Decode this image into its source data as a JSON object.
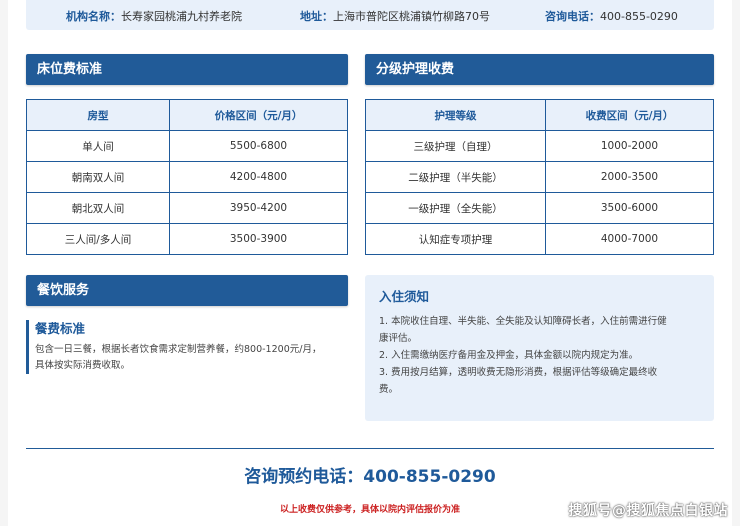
{
  "info": {
    "name_label": "机构名称：",
    "name_value": "长寿家园桃浦九村养老院",
    "addr_label": "地址：",
    "addr_value": "上海市普陀区桃浦镇竹柳路70号",
    "phone_label": "咨询电话：",
    "phone_value": "400-855-0290"
  },
  "bed_fee": {
    "title": "床位费标准",
    "headers": [
      "房型",
      "价格区间（元/月）"
    ],
    "rows": [
      [
        "单人间",
        "5500-6800"
      ],
      [
        "朝南双人间",
        "4200-4800"
      ],
      [
        "朝北双人间",
        "3950-4200"
      ],
      [
        "三人间/多人间",
        "3500-3900"
      ]
    ]
  },
  "care_fee": {
    "title": "分级护理收费",
    "headers": [
      "护理等级",
      "收费区间（元/月）"
    ],
    "rows": [
      [
        "三级护理（自理）",
        "1000-2000"
      ],
      [
        "二级护理（半失能）",
        "2000-3500"
      ],
      [
        "一级护理（全失能）",
        "3500-6000"
      ],
      [
        "认知症专项护理",
        "4000-7000"
      ]
    ]
  },
  "catering": {
    "title": "餐饮服务",
    "sub_title": "餐费标准",
    "line1": "包含一日三餐，根据长者饮食需求定制营养餐，约800-1200元/月，",
    "line2": "具体按实际消费收取。"
  },
  "notice": {
    "title": "入住须知",
    "items": [
      "1. 本院收住自理、半失能、全失能及认知障碍长者，入住前需进行健",
      "康评估。",
      "2. 入住需缴纳医疗备用金及押金，具体金额以院内规定为准。",
      "3. 费用按月结算，透明收费无隐形消费，根据评估等级确定最终收",
      "费。"
    ]
  },
  "footer": {
    "phone_line": "咨询预约电话：400-855-0290",
    "disclaimer": "以上收费仅供参考，具体以院内评估报价为准",
    "watermark": "搜狐号@搜狐焦点白银站"
  },
  "colors": {
    "primary": "#215b98",
    "light_bg": "#e8f0fa",
    "disclaimer": "#cc2222"
  }
}
